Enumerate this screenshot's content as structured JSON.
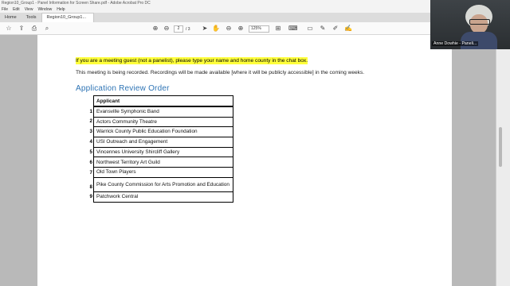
{
  "window": {
    "title": "Region10_Group1 - Panel Information for Screen Share.pdf - Adobe Acrobat Pro DC"
  },
  "menu": {
    "items": [
      "File",
      "Edit",
      "View",
      "Window",
      "Help"
    ]
  },
  "tabs": {
    "home": "Home",
    "tools": "Tools",
    "document": "Region10_Group1..."
  },
  "toolbar": {
    "icons": [
      "star-icon",
      "cloud-upload-icon",
      "print-icon",
      "search-icon",
      "prev-page-icon",
      "next-page-icon",
      "select-icon",
      "hand-icon",
      "zoom-out-icon",
      "zoom-in-icon",
      "crop-icon",
      "keyboard-icon",
      "comment-icon",
      "pen-icon",
      "highlighter-icon",
      "sign-icon"
    ],
    "current_page": "2",
    "total_pages": "/ 3",
    "zoom": "125%"
  },
  "document": {
    "notice": "If you are a meeting guest (not a panelist), please type your name and home county in the chat box.",
    "recording_note": "This meeting is being recorded. Recordings will be made available [where it will be publicly accessible] in the coming weeks.",
    "heading": "Application Review Order",
    "table": {
      "header": "Applicant",
      "rows": [
        {
          "num": "1",
          "name": "Evansville Symphonic Band"
        },
        {
          "num": "2",
          "name": "Actors Community Theatre"
        },
        {
          "num": "3",
          "name": "Warrick County Public Education Foundation"
        },
        {
          "num": "4",
          "name": "USI Outreach and Engagement"
        },
        {
          "num": "5",
          "name": "Vincennes University Shircliff Gallery"
        },
        {
          "num": "6",
          "name": "Northwest Territory Art Guild"
        },
        {
          "num": "7",
          "name": "Old Town Players"
        },
        {
          "num": "8",
          "name": "Pike County Commission for Arts Promotion and Education"
        },
        {
          "num": "9",
          "name": "Patchwork Central"
        }
      ]
    }
  },
  "video": {
    "participant": "Anne Dowhie - Paneli..."
  },
  "colors": {
    "highlight": "#ffff3b",
    "heading": "#2e74b5",
    "page_background": "#ffffff",
    "viewer_background": "#b9b9b9"
  }
}
